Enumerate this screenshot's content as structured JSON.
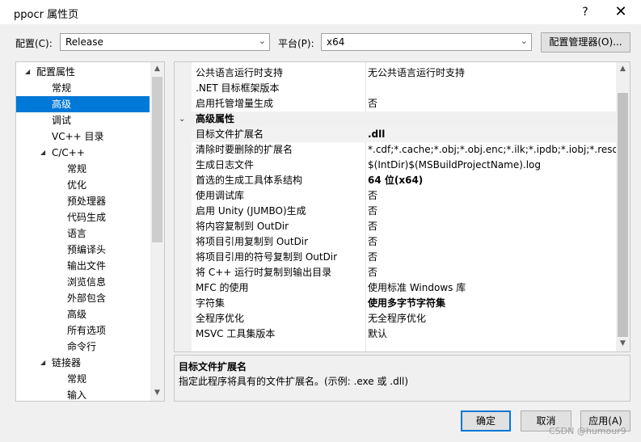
{
  "window": {
    "title": "ppocr 属性页",
    "help_glyph": "?",
    "close_glyph": "✕"
  },
  "toolbar": {
    "config_label": "配置(C):",
    "config_value": "Release",
    "platform_label": "平台(P):",
    "platform_value": "x64",
    "config_manager_label": "配置管理器(O)..."
  },
  "tree": {
    "items": [
      {
        "label": "配置属性",
        "expanded": true
      },
      {
        "label": "常规"
      },
      {
        "label": "高级",
        "selected": true
      },
      {
        "label": "调试"
      },
      {
        "label": "VC++ 目录"
      },
      {
        "label": "C/C++",
        "expanded": true
      },
      {
        "label": "常规"
      },
      {
        "label": "优化"
      },
      {
        "label": "预处理器"
      },
      {
        "label": "代码生成"
      },
      {
        "label": "语言"
      },
      {
        "label": "预编译头"
      },
      {
        "label": "输出文件"
      },
      {
        "label": "浏览信息"
      },
      {
        "label": "外部包含"
      },
      {
        "label": "高级"
      },
      {
        "label": "所有选项"
      },
      {
        "label": "命令行"
      },
      {
        "label": "链接器",
        "expanded": true
      },
      {
        "label": "常规"
      },
      {
        "label": "输入"
      }
    ]
  },
  "grid": {
    "rows_top": [
      {
        "name": "公共语言运行时支持",
        "value": "无公共语言运行时支持"
      },
      {
        "name": ".NET 目标框架版本",
        "value": ""
      },
      {
        "name": "启用托管增量生成",
        "value": "否"
      }
    ],
    "group_label": "高级属性",
    "rows": [
      {
        "name": "目标文件扩展名",
        "value": ".dll",
        "bold": true,
        "selected": true
      },
      {
        "name": "清除时要删除的扩展名",
        "value": "*.cdf;*.cache;*.obj;*.obj.enc;*.ilk;*.ipdb;*.iobj;*.resources"
      },
      {
        "name": "生成日志文件",
        "value": "$(IntDir)$(MSBuildProjectName).log"
      },
      {
        "name": "首选的生成工具体系结构",
        "value": "64 位(x64)",
        "bold": true
      },
      {
        "name": "使用调试库",
        "value": "否"
      },
      {
        "name": "启用 Unity (JUMBO)生成",
        "value": "否"
      },
      {
        "name": "将内容复制到 OutDir",
        "value": "否"
      },
      {
        "name": "将项目引用复制到 OutDir",
        "value": "否"
      },
      {
        "name": "将项目引用的符号复制到 OutDir",
        "value": "否"
      },
      {
        "name": "将 C++ 运行时复制到输出目录",
        "value": "否"
      },
      {
        "name": "MFC 的使用",
        "value": "使用标准 Windows 库"
      },
      {
        "name": "字符集",
        "value": "使用多字节字符集",
        "bold": true
      },
      {
        "name": "全程序优化",
        "value": "无全程序优化"
      },
      {
        "name": "MSVC 工具集版本",
        "value": "默认"
      }
    ]
  },
  "description": {
    "title": "目标文件扩展名",
    "text": "指定此程序将具有的文件扩展名。(示例: .exe 或 .dll)"
  },
  "buttons": {
    "ok": "确定",
    "cancel": "取消",
    "apply": "应用(A)"
  },
  "watermark": "CSDN @humour9"
}
